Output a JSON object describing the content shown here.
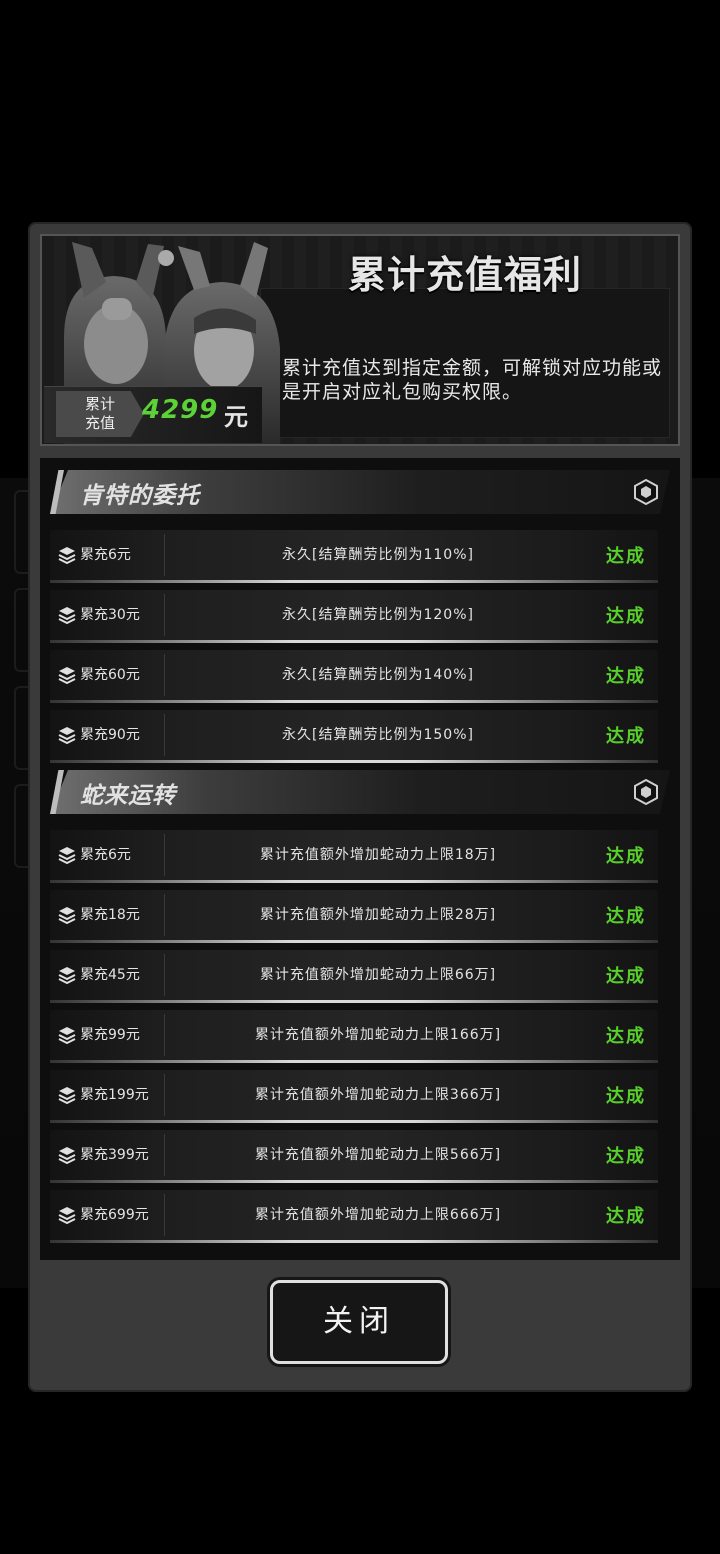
{
  "panel": {
    "title": "累计充值福利",
    "description": "累计充值达到指定金额，可解锁对应功能或是开启对应礼包购买权限。",
    "total": {
      "label_line1": "累计",
      "label_line2": "充值",
      "value": "4299",
      "unit": "元"
    }
  },
  "sections": [
    {
      "title": "肯特的委托",
      "rows": [
        {
          "condition": "累充6元",
          "reward": "永久[结算酬劳比例为110%]",
          "status": "达成"
        },
        {
          "condition": "累充30元",
          "reward": "永久[结算酬劳比例为120%]",
          "status": "达成"
        },
        {
          "condition": "累充60元",
          "reward": "永久[结算酬劳比例为140%]",
          "status": "达成"
        },
        {
          "condition": "累充90元",
          "reward": "永久[结算酬劳比例为150%]",
          "status": "达成"
        }
      ]
    },
    {
      "title": "蛇来运转",
      "rows": [
        {
          "condition": "累充6元",
          "reward": "累计充值额外增加蛇动力上限18万]",
          "status": "达成"
        },
        {
          "condition": "累充18元",
          "reward": "累计充值额外增加蛇动力上限28万]",
          "status": "达成"
        },
        {
          "condition": "累充45元",
          "reward": "累计充值额外增加蛇动力上限66万]",
          "status": "达成"
        },
        {
          "condition": "累充99元",
          "reward": "累计充值额外增加蛇动力上限166万]",
          "status": "达成"
        },
        {
          "condition": "累充199元",
          "reward": "累计充值额外增加蛇动力上限366万]",
          "status": "达成"
        },
        {
          "condition": "累充399元",
          "reward": "累计充值额外增加蛇动力上限566万]",
          "status": "达成"
        },
        {
          "condition": "累充699元",
          "reward": "累计充值额外增加蛇动力上限666万]",
          "status": "达成"
        }
      ]
    }
  ],
  "buttons": {
    "close_label": "关闭"
  },
  "colors": {
    "status_green": "#58d02c",
    "total_green": "#5bd236"
  },
  "icons": {
    "row_icon": "stack-layers-icon",
    "section_icon": "hexagon-icon"
  }
}
